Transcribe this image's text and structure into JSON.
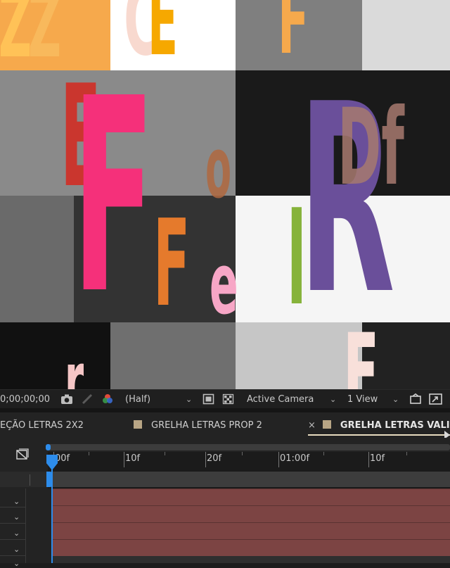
{
  "viewer": {
    "timecode": "0;00;00;00",
    "resolution": "(Half)",
    "camera": "Active Camera",
    "views": "1 View",
    "icons": [
      "camera-snapshot-icon",
      "show-snapshot-icon",
      "color-channels-icon",
      "region-of-interest-icon",
      "transparency-grid-icon",
      "fast-previews-icon",
      "toggle-pixel-aspect-icon"
    ]
  },
  "tabs": [
    {
      "label": "EÇÃO LETRAS 2X2",
      "color": "#b8a585",
      "active": false
    },
    {
      "label": "GRELHA LETRAS PROP 2",
      "color": "#b8a585",
      "active": false
    },
    {
      "label": "GRELHA LETRAS VALID",
      "color": "#b8a585",
      "active": true,
      "close": "×"
    }
  ],
  "timeline": {
    "ruler_labels": [
      "00f",
      "10f",
      "20f",
      "01:00f",
      "10f"
    ],
    "layer_color": "#7c4443",
    "layer_rows": 4
  },
  "composition": {
    "letters": [
      "Z",
      "Z",
      "C",
      "E",
      "F",
      "E",
      "F",
      "o",
      "R",
      "Df",
      "F",
      "e",
      "l",
      "E",
      "r"
    ]
  }
}
